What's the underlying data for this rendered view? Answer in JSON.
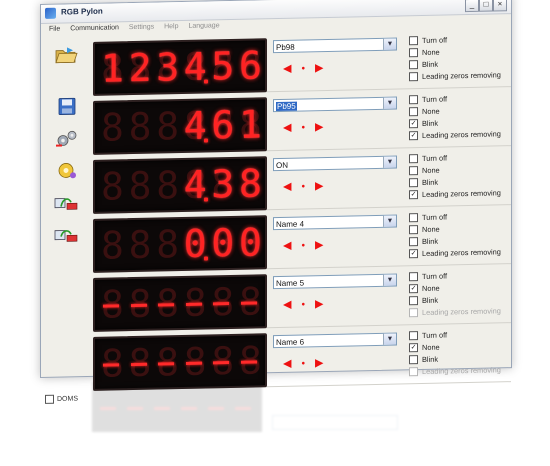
{
  "window": {
    "title": "RGB Pylon",
    "minimize": "_",
    "maximize": "□",
    "close": "×"
  },
  "menu": [
    "File",
    "Communication",
    "Settings",
    "Help",
    "Language"
  ],
  "toolbar": [
    {
      "name": "open-folder-icon"
    },
    {
      "name": "save-disk-icon"
    },
    {
      "name": "gears-icon"
    },
    {
      "name": "gear-settings-icon"
    },
    {
      "name": "upload-monitor-icon"
    },
    {
      "name": "download-monitor-icon"
    }
  ],
  "doms_label": "DOMS",
  "arrow_left": "◀",
  "arrow_dot": "•",
  "arrow_right": "▶",
  "option_labels": [
    "Turn off",
    "None",
    "Blink",
    "Leading zeros removing"
  ],
  "channels": [
    {
      "display": [
        "1",
        "2",
        "3",
        "4.",
        "5",
        "6"
      ],
      "dashes": false,
      "combo": "Pb98",
      "selected": false,
      "options": {
        "turn_off": false,
        "none": false,
        "blink": false,
        "leading_zeros": false,
        "leading_disabled": false
      }
    },
    {
      "display": [
        "",
        "",
        "",
        "4.",
        "6",
        "1"
      ],
      "dashes": false,
      "combo": "Pb95",
      "selected": true,
      "options": {
        "turn_off": false,
        "none": false,
        "blink": true,
        "leading_zeros": true,
        "leading_disabled": false
      }
    },
    {
      "display": [
        "",
        "",
        "",
        "4.",
        "3",
        "8"
      ],
      "dashes": false,
      "combo": "ON",
      "selected": false,
      "options": {
        "turn_off": false,
        "none": false,
        "blink": false,
        "leading_zeros": true,
        "leading_disabled": false
      }
    },
    {
      "display": [
        "",
        "",
        "",
        "0.",
        "0",
        "0"
      ],
      "dashes": false,
      "combo": "Name 4",
      "selected": false,
      "options": {
        "turn_off": false,
        "none": false,
        "blink": false,
        "leading_zeros": true,
        "leading_disabled": false
      }
    },
    {
      "display": [
        "-",
        "-",
        "-",
        "-",
        "-",
        "-"
      ],
      "dashes": true,
      "combo": "Name 5",
      "selected": false,
      "options": {
        "turn_off": false,
        "none": true,
        "blink": false,
        "leading_zeros": false,
        "leading_disabled": true
      }
    },
    {
      "display": [
        "-",
        "-",
        "-",
        "-",
        "-",
        "-"
      ],
      "dashes": true,
      "combo": "Name 6",
      "selected": false,
      "options": {
        "turn_off": false,
        "none": true,
        "blink": false,
        "leading_zeros": false,
        "leading_disabled": true
      }
    }
  ],
  "colors": {
    "led": "#ff2323",
    "led_off": "#3a1010",
    "arrow": "#e11111",
    "selection": "#316ac5"
  }
}
